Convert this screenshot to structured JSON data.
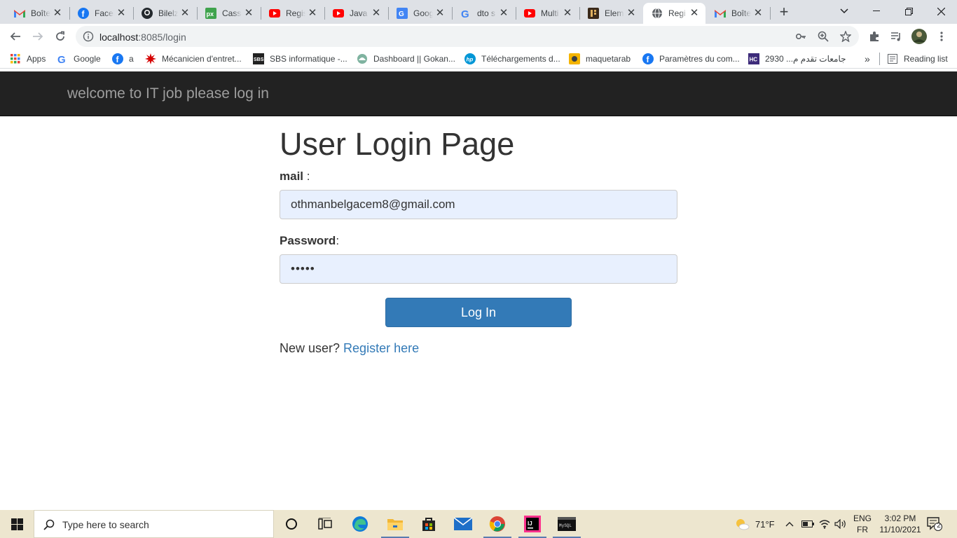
{
  "tabs": [
    {
      "title": "Boîte",
      "icon": "gmail-icon",
      "active": false
    },
    {
      "title": "Facebook",
      "icon": "facebook-icon",
      "active": false
    },
    {
      "title": "Bilelz",
      "icon": "github-icon",
      "active": false
    },
    {
      "title": "Cassc",
      "icon": "pixlr-icon",
      "active": false
    },
    {
      "title": "Regis",
      "icon": "youtube-icon",
      "active": false
    },
    {
      "title": "Java",
      "icon": "youtube-icon",
      "active": false
    },
    {
      "title": "Goog",
      "icon": "google-translate-icon",
      "active": false
    },
    {
      "title": "dto s",
      "icon": "google-icon",
      "active": false
    },
    {
      "title": "Multi",
      "icon": "youtube-icon",
      "active": false
    },
    {
      "title": "Elem",
      "icon": "elementor-icon",
      "active": false
    },
    {
      "title": "Regi",
      "icon": "globe-icon",
      "active": true
    },
    {
      "title": "Boîte",
      "icon": "gmail-icon",
      "active": false
    }
  ],
  "address": {
    "host": "localhost",
    "path": ":8085/login"
  },
  "bookmarks": [
    {
      "label": "Apps",
      "icon": "apps-grid-icon"
    },
    {
      "label": "Google",
      "icon": "google-icon"
    },
    {
      "label": "a",
      "icon": "facebook-icon"
    },
    {
      "label": "Mécanicien d'entret...",
      "icon": "star-burst-icon"
    },
    {
      "label": "SBS informatique -...",
      "icon": "sbs-icon"
    },
    {
      "label": "Dashboard || Gokan...",
      "icon": "dashboard-icon"
    },
    {
      "label": "Téléchargements d...",
      "icon": "hp-icon"
    },
    {
      "label": "maquetarab",
      "icon": "maquetarab-icon"
    },
    {
      "label": "Paramètres du com...",
      "icon": "facebook-icon"
    },
    {
      "label": "جامعات تقدم م... 2930",
      "icon": "hc-icon"
    }
  ],
  "reading_list": "Reading list",
  "page": {
    "brand": "welcome to IT job please log in",
    "title": "User Login Page",
    "mail_label": "mail",
    "mail_suffix": " :",
    "mail_value": "othmanbelgacem8@gmail.com",
    "password_label": "Password",
    "password_suffix": ":",
    "password_value": "•••••",
    "login_button": "Log In",
    "new_user_text": "New user? ",
    "register_link": "Register here"
  },
  "taskbar": {
    "search_placeholder": "Type here to search",
    "weather": "71°F",
    "lang_top": "ENG",
    "lang_bottom": "FR",
    "time": "3:02 PM",
    "date": "11/10/2021",
    "notifications": "2"
  },
  "colors": {
    "navbar_bg": "#222222",
    "brand_text": "#9d9d9d",
    "button_primary": "#337ab7",
    "autofill_bg": "#e8f0fe",
    "taskbar_bg": "#ede6cf"
  }
}
